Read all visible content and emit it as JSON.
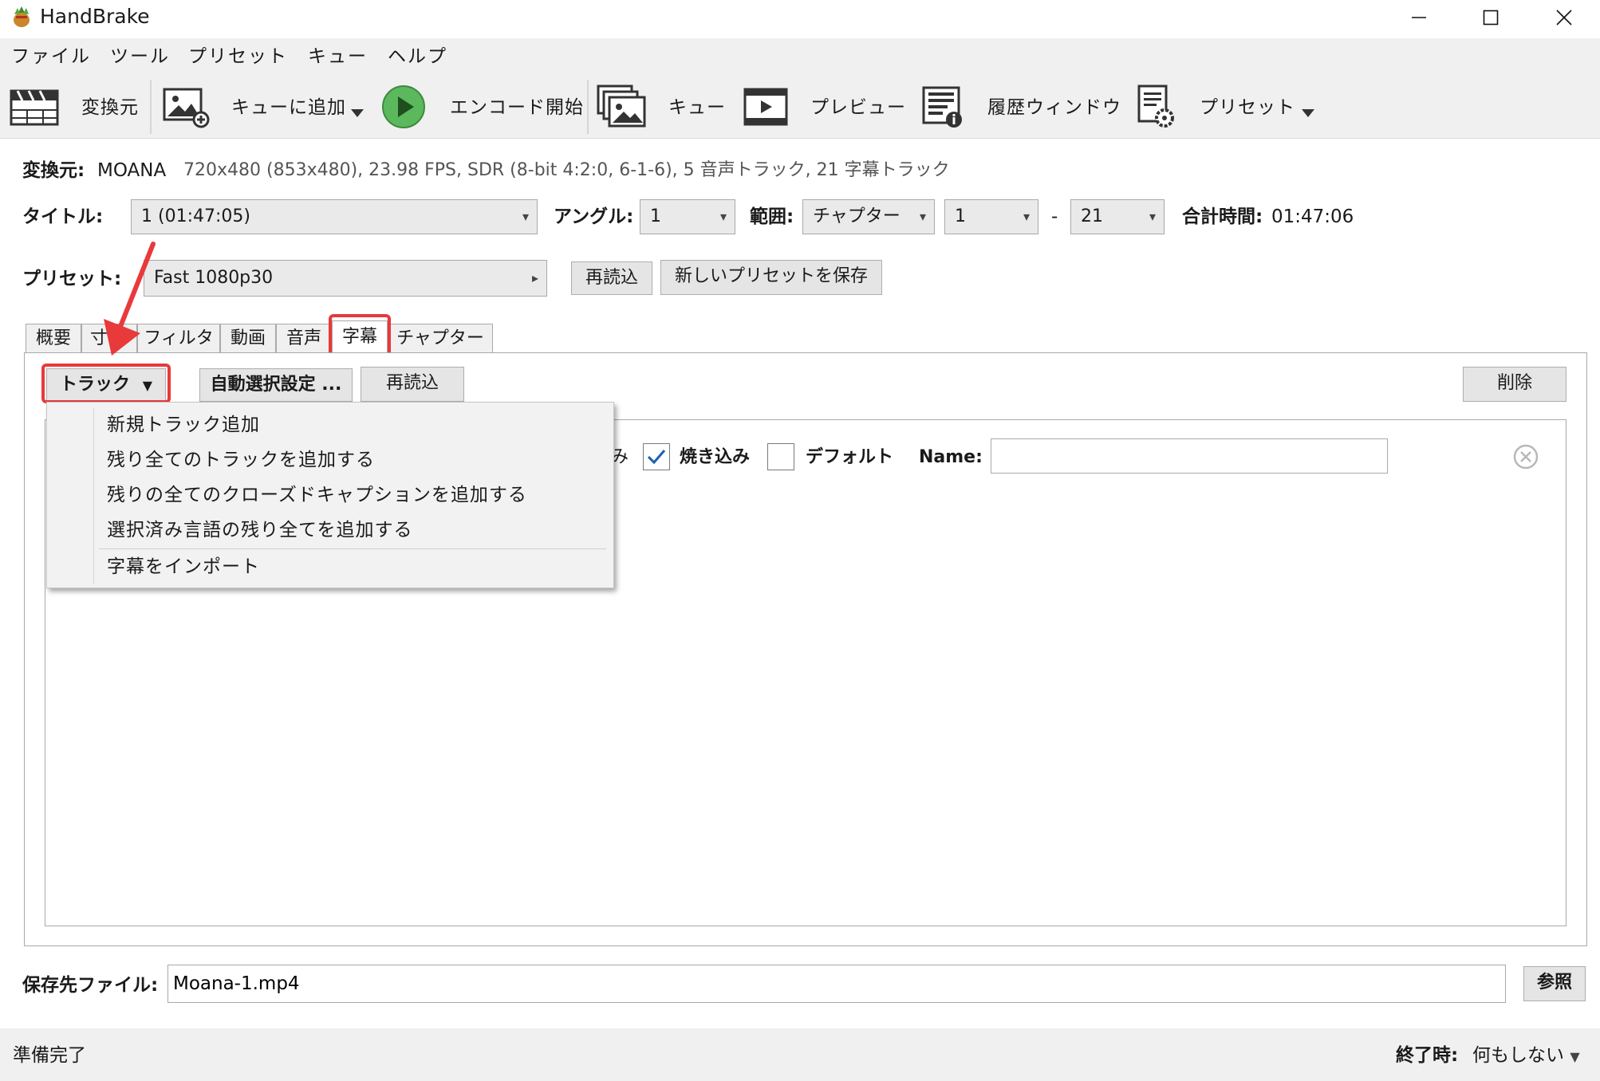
{
  "window": {
    "title": "HandBrake",
    "minimize_icon": "minimize-icon",
    "maximize_icon": "maximize-icon",
    "close_icon": "close-icon"
  },
  "menu": [
    "ファイル",
    "ツール",
    "プリセット",
    "キュー",
    "ヘルプ"
  ],
  "toolbar": {
    "source": "変換元",
    "add_queue": "キューに追加",
    "start": "エンコード開始",
    "queue": "キュー",
    "preview": "プレビュー",
    "activity": "履歴ウィンドウ",
    "presets": "プリセット"
  },
  "source": {
    "label": "変換元:",
    "name": "MOANA",
    "info": "720x480 (853x480), 23.98 FPS, SDR (8-bit 4:2:0, 6-1-6), 5 音声トラック, 21 字幕トラック"
  },
  "title_row": {
    "title_label": "タイトル:",
    "title_value": "1  (01:47:05)",
    "angle_label": "アングル:",
    "angle_value": "1",
    "range_label": "範囲:",
    "range_type": "チャプター",
    "range_start": "1",
    "range_dash": "-",
    "range_end": "21",
    "duration_label": "合計時間:",
    "duration_value": "01:47:06"
  },
  "preset_row": {
    "label": "プリセット:",
    "value": "Fast 1080p30",
    "reload": "再読込",
    "save_new": "新しいプリセットを保存"
  },
  "tabs": [
    "概要",
    "寸",
    "フィルタ",
    "動画",
    "音声",
    "字幕",
    "チャプター"
  ],
  "subtitles": {
    "tracks_button": "トラック",
    "auto_select": "自動選択設定 ...",
    "reload": "再読込",
    "remove": "削除",
    "partial_label": "み",
    "burn_in": "焼き込み",
    "default": "デフォルト",
    "name_label": "Name:",
    "name_value": ""
  },
  "dropdown": {
    "items": [
      "新規トラック追加",
      "残り全てのトラックを追加する",
      "残りの全てのクローズドキャプションを追加する",
      "選択済み言語の残り全てを追加する"
    ],
    "import": "字幕をインポート"
  },
  "destination": {
    "label": "保存先ファイル:",
    "value": "Moana-1.mp4",
    "browse": "参照"
  },
  "status": {
    "text": "準備完了",
    "when_done_label": "終了時:",
    "when_done_value": "何もしない"
  },
  "colors": {
    "highlight": "#e8393b",
    "start_button": "#5cb85c",
    "check": "#1e5fb4"
  }
}
